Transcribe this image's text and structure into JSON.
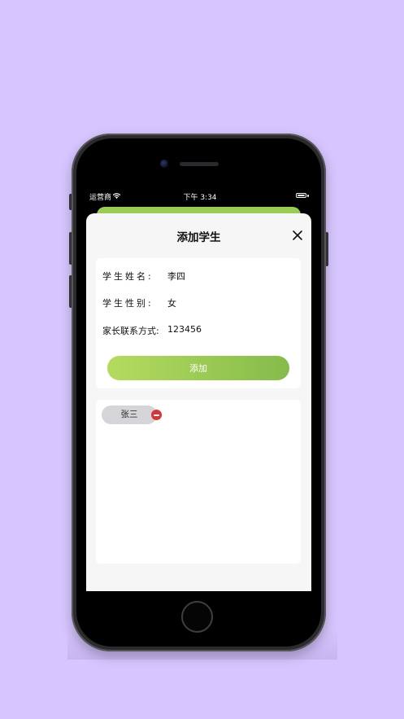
{
  "status_bar": {
    "carrier": "运营商",
    "time": "下午 3:34"
  },
  "sheet": {
    "title": "添加学生",
    "form": {
      "name_label": "学生姓名:",
      "name_value": "李四",
      "gender_label": "学生性别:",
      "gender_value": "女",
      "contact_label": "家长联系方式:",
      "contact_value": "123456"
    },
    "add_button_label": "添加",
    "students": [
      {
        "name": "张三"
      }
    ]
  },
  "colors": {
    "background": "#d6c5fe",
    "accent_green_start": "#b4db5f",
    "accent_green_end": "#85bb4b",
    "remove_red": "#d4373a"
  },
  "icons": [
    "wifi-icon",
    "battery-icon",
    "close-icon",
    "remove-icon"
  ]
}
